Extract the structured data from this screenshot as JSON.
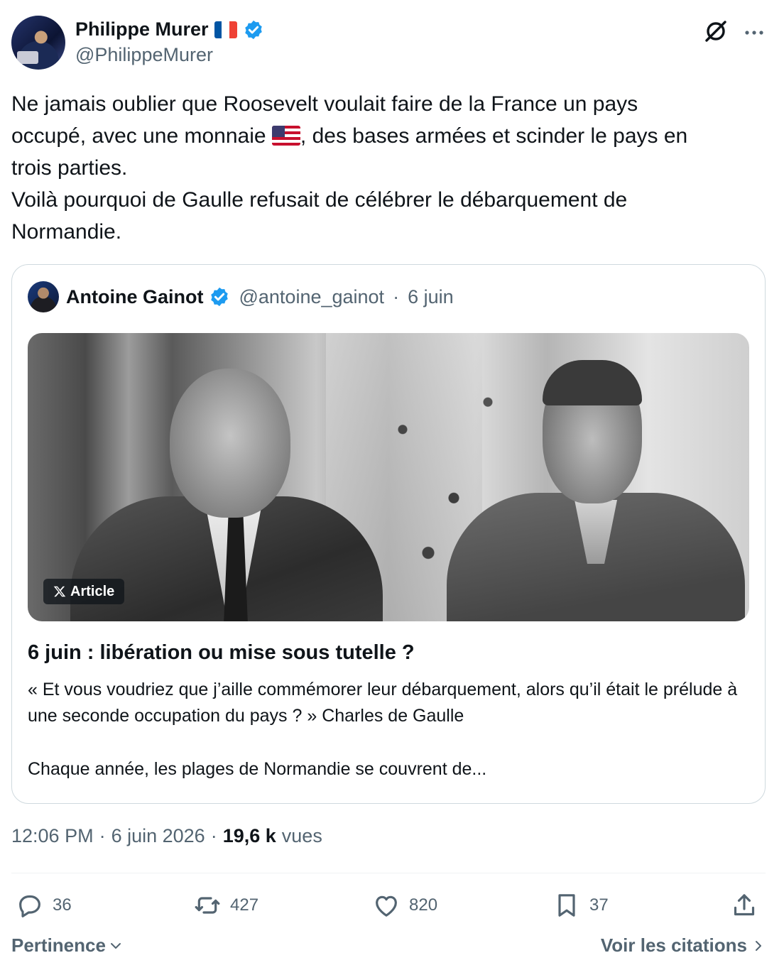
{
  "author": {
    "name": "Philippe Murer",
    "handle": "@PhilippeMurer",
    "country_flag": "france-flag",
    "verified": true
  },
  "tweet": {
    "line1": "Ne jamais oublier que Roosevelt voulait faire de la France un pays",
    "line2_before_flag": "occupé, avec une monnaie ",
    "inline_flag": "usa-flag",
    "line2_after_flag": ", des bases armées et scinder le pays en",
    "line3": "trois parties.",
    "line4": "Voilà pourquoi de Gaulle refusait de célébrer le débarquement de",
    "line5": "Normandie."
  },
  "quoted": {
    "name": "Antoine Gainot",
    "handle": "@antoine_gainot",
    "separator": "·",
    "date": "6 juin",
    "badge_label": "Article",
    "article_title": "6 juin : libération ou mise sous tutelle ?",
    "article_excerpt": "« Et vous voudriez que j’aille commémorer leur débarquement, alors qu’il était le prélude à une seconde occupation du pays ? » Charles de Gaulle",
    "article_more": "Chaque année, les plages de Normandie se couvrent de..."
  },
  "meta": {
    "time": "12:06 PM",
    "separator": "·",
    "date": "6 juin 2026",
    "views_count": "19,6 k",
    "views_label": "vues"
  },
  "actions": {
    "replies": "36",
    "reposts": "427",
    "likes": "820",
    "bookmarks": "37"
  },
  "footer": {
    "sort_label": "Pertinence",
    "quotes_label": "Voir les citations"
  },
  "colors": {
    "text_primary": "#0f1419",
    "text_secondary": "#536471",
    "verified_blue": "#1d9bf0",
    "border": "#cfd9de"
  }
}
